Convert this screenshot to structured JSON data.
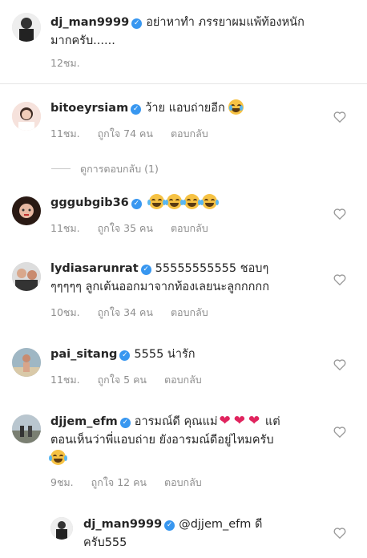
{
  "caption": {
    "username": "dj_man9999",
    "text_line1": "อย่าหาทำ ภรรยาผมแพ้ท้องหนัก",
    "text_line2": "มากครับ......",
    "time": "12ชม."
  },
  "comments": [
    {
      "username": "bitoeyrsiam",
      "text": "ว้าย แอบถ่ายอีก",
      "time": "11ชม.",
      "likes": "ถูกใจ 74 คน",
      "reply": "ตอบกลับ"
    },
    {
      "username": "gggubgib36",
      "text": "",
      "time": "11ชม.",
      "likes": "ถูกใจ 35 คน",
      "reply": "ตอบกลับ"
    },
    {
      "username": "lydiasarunrat",
      "text_line1": "55555555555 ชอบๆ",
      "text_line2": "ๆๆๆๆๆ ลูกเต้นออกมาจากท้องเลยนะลูกกกกก",
      "time": "10ชม.",
      "likes": "ถูกใจ 34 คน",
      "reply": "ตอบกลับ"
    },
    {
      "username": "pai_sitang",
      "text": "5555 น่ารัก",
      "time": "11ชม.",
      "likes": "ถูกใจ 5 คน",
      "reply": "ตอบกลับ"
    },
    {
      "username": "djjem_efm",
      "text_a": "อารมณ์ดี คุณแม่",
      "text_b": "แต่",
      "text_line2": "ตอนเห็นว่าพี่แอบถ่าย ยังอารมณ์ดีอยู่ไหมครับ",
      "time": "9ชม.",
      "likes": "ถูกใจ 12 คน",
      "reply": "ตอบกลับ"
    },
    {
      "username": "dj_man9999",
      "mention": "@djjem_efm",
      "text_a": "ดี",
      "text_line2": "ครับ555"
    }
  ],
  "view_replies": "ดูการตอบกลับ (1)",
  "icons": {
    "verified": "verified-badge-icon",
    "like": "heart-outline-icon"
  },
  "colors": {
    "verified": "#3897f0",
    "muted": "#8e8e8e",
    "heart_red": "#e0245e"
  }
}
